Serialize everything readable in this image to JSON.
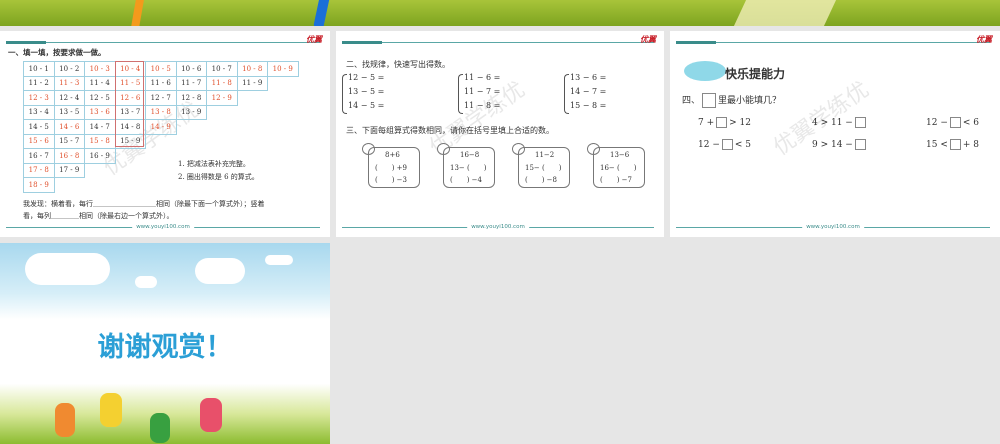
{
  "slides": [
    {
      "logo": "优翼",
      "footer": "www.youyi100.com",
      "watermark": "优翼学练优",
      "heading": "一、填一填，按要求做一做。",
      "table": [
        [
          {
            "t": "10 - 1",
            "r": 0
          },
          {
            "t": "10 - 2",
            "r": 0
          },
          {
            "t": "10 - 3",
            "r": 1
          },
          {
            "t": "10 - 4",
            "r": 1
          },
          {
            "t": "10 - 5",
            "r": 1
          },
          {
            "t": "10 - 6",
            "r": 0
          },
          {
            "t": "10 - 7",
            "r": 0
          },
          {
            "t": "10 - 8",
            "r": 1
          },
          {
            "t": "10 - 9",
            "r": 1
          }
        ],
        [
          {
            "t": "11 - 2",
            "r": 0
          },
          {
            "t": "11 - 3",
            "r": 1
          },
          {
            "t": "11 - 4",
            "r": 0
          },
          {
            "t": "11 - 5",
            "r": 1
          },
          {
            "t": "11 - 6",
            "r": 0
          },
          {
            "t": "11 - 7",
            "r": 0
          },
          {
            "t": "11 - 8",
            "r": 1
          },
          {
            "t": "11 - 9",
            "r": 0
          }
        ],
        [
          {
            "t": "12 - 3",
            "r": 1
          },
          {
            "t": "12 - 4",
            "r": 0
          },
          {
            "t": "12 - 5",
            "r": 0
          },
          {
            "t": "12 - 6",
            "r": 1
          },
          {
            "t": "12 - 7",
            "r": 0
          },
          {
            "t": "12 - 8",
            "r": 0
          },
          {
            "t": "12 - 9",
            "r": 1
          }
        ],
        [
          {
            "t": "13 - 4",
            "r": 0
          },
          {
            "t": "13 - 5",
            "r": 0
          },
          {
            "t": "13 - 6",
            "r": 1
          },
          {
            "t": "13 - 7",
            "r": 0
          },
          {
            "t": "13 - 8",
            "r": 1
          },
          {
            "t": "13 - 9",
            "r": 0
          }
        ],
        [
          {
            "t": "14 - 5",
            "r": 0
          },
          {
            "t": "14 - 6",
            "r": 1
          },
          {
            "t": "14 - 7",
            "r": 0
          },
          {
            "t": "14 - 8",
            "r": 0
          },
          {
            "t": "14 - 9",
            "r": 1
          }
        ],
        [
          {
            "t": "15 - 6",
            "r": 1
          },
          {
            "t": "15 - 7",
            "r": 0
          },
          {
            "t": "15 - 8",
            "r": 1
          },
          {
            "t": "15 - 9",
            "r": 0
          }
        ],
        [
          {
            "t": "16 - 7",
            "r": 0
          },
          {
            "t": "16 - 8",
            "r": 1
          },
          {
            "t": "16 - 9",
            "r": 0
          }
        ],
        [
          {
            "t": "17 - 8",
            "r": 1
          },
          {
            "t": "17 - 9",
            "r": 0
          }
        ],
        [
          {
            "t": "18 - 9",
            "r": 1
          }
        ]
      ],
      "notes": [
        "1. 把减法表补充完整。",
        "2. 圈出得数是 6 的算式。"
      ],
      "finding_1": "我发现：横着看，每行＿＿＿＿＿＿＿＿＿相同（除最下面一个算式外）；竖着",
      "finding_2": "看，每列＿＿＿＿相同（除最右边一个算式外）。"
    },
    {
      "logo": "优翼",
      "footer": "www.youyi100.com",
      "watermark": "优翼学练优",
      "heading2": "二、找规律，快速写出得数。",
      "groups": [
        [
          "12 − 5 =",
          "13 − 5 =",
          "14 − 5 ="
        ],
        [
          "11 − 6 =",
          "11 − 7 =",
          "11 − 8 ="
        ],
        [
          "13 − 6 =",
          "14 − 7 =",
          "15 − 8 ="
        ]
      ],
      "heading3": "三、下面每组算式得数相同，请你在括号里填上合适的数。",
      "boxes": [
        [
          "8+6",
          "(　　) +9",
          "(　　) −3"
        ],
        [
          "16−8",
          "13− (　　)",
          "(　　) −4"
        ],
        [
          "11−2",
          "15− (　　)",
          "(　　) −8"
        ],
        [
          "13−6",
          "16− (　　)",
          "(　　) −7"
        ]
      ]
    },
    {
      "logo": "优翼",
      "footer": "www.youyi100.com",
      "watermark": "优翼学练优",
      "banner": "快乐提能力",
      "heading4_pre": "四、",
      "heading4_post": "里最小能填几？",
      "items": [
        [
          "7 +",
          "> 12"
        ],
        [
          "4 > 11 −",
          ""
        ],
        [
          "12 −",
          "< 6"
        ],
        [
          "12 −",
          "< 5"
        ],
        [
          "9 > 14 −",
          ""
        ],
        [
          "15 <",
          "+ 8"
        ]
      ]
    },
    {
      "title": "谢谢观赏！"
    }
  ]
}
